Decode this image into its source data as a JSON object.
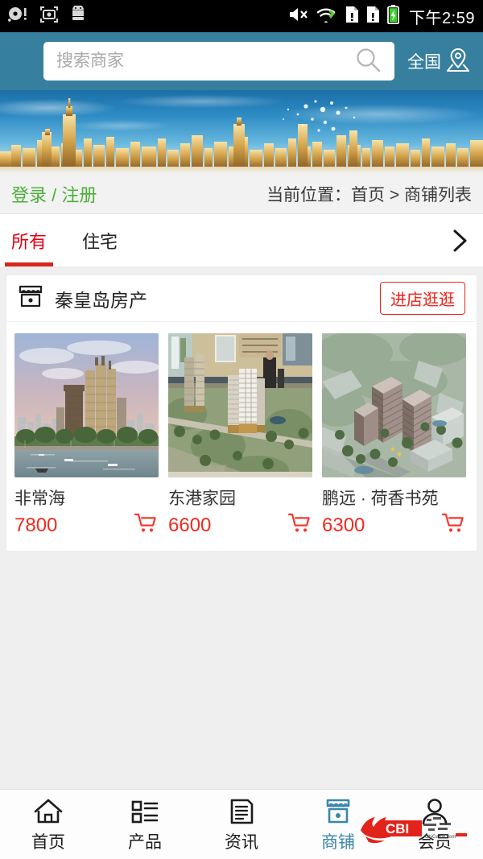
{
  "statusbar": {
    "time": "下午2:59",
    "left_icons": [
      "record-icon",
      "screenshot-icon",
      "android-icon"
    ],
    "right_icons": [
      "mute-icon",
      "wifi-icon",
      "sim1-alert-icon",
      "sim2-alert-icon",
      "battery-charging-icon"
    ]
  },
  "header": {
    "search_placeholder": "搜索商家",
    "search_value": "",
    "search_icon": "search-icon",
    "location_label": "全国",
    "location_icon": "map-pin-icon",
    "background_color": "#377f9e"
  },
  "banner": {
    "alt": "城市天际线横幅"
  },
  "subbar": {
    "login_label": "登录 / 注册",
    "login_color": "#4caf37",
    "breadcrumb": "当前位置：首页 > 商铺列表"
  },
  "tabs": {
    "items": [
      {
        "label": "所有",
        "active": true
      },
      {
        "label": "住宅",
        "active": false
      }
    ],
    "more_icon": "chevron-right-icon",
    "active_color": "#e60012"
  },
  "store": {
    "icon": "shop-icon",
    "name": "秦皇岛房产",
    "enter_button": "进店逛逛",
    "enter_button_color": "#e8231b",
    "products": [
      {
        "title": "非常海",
        "price": "7800",
        "cart_icon": "cart-icon",
        "image": "riverside-towers"
      },
      {
        "title": "东港家园",
        "price": "6600",
        "cart_icon": "cart-icon",
        "image": "model-hall-tower"
      },
      {
        "title": "鹏远 · 荷香书苑",
        "price": "6300",
        "cart_icon": "cart-icon",
        "image": "aerial-complex"
      }
    ],
    "price_color": "#f22a1e"
  },
  "bottom_nav": {
    "items": [
      {
        "label": "首页",
        "icon": "home-icon",
        "active": false
      },
      {
        "label": "产品",
        "icon": "list-icon",
        "active": false
      },
      {
        "label": "资讯",
        "icon": "news-icon",
        "active": false
      },
      {
        "label": "商铺",
        "icon": "shop-icon",
        "active": true
      },
      {
        "label": "会员",
        "icon": "user-icon",
        "active": false
      }
    ],
    "active_color": "#3b86aa"
  },
  "watermark": {
    "text": "CBI",
    "subtext": "ChiGame.com",
    "color": "#e2231a"
  }
}
